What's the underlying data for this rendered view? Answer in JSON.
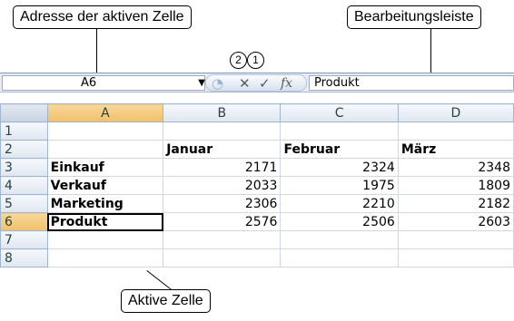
{
  "callouts": {
    "active_cell_address": "Adresse der aktiven Zelle",
    "formula_bar": "Bearbeitungsleiste",
    "active_cell": "Aktive Zelle",
    "marker_2": "2",
    "marker_1": "1"
  },
  "formula_bar": {
    "name_box": "A6",
    "cancel_icon": "✕",
    "enter_icon": "✓",
    "fx_label": "fx",
    "content": "Produkt"
  },
  "sheet": {
    "columns": [
      "A",
      "B",
      "C",
      "D"
    ],
    "rows": [
      {
        "num": "1",
        "cells": [
          "",
          "",
          "",
          ""
        ]
      },
      {
        "num": "2",
        "cells": [
          "",
          "Januar",
          "Februar",
          "März"
        ]
      },
      {
        "num": "3",
        "cells": [
          "Einkauf",
          "2171",
          "2324",
          "2348"
        ]
      },
      {
        "num": "4",
        "cells": [
          "Verkauf",
          "2033",
          "1975",
          "1809"
        ]
      },
      {
        "num": "5",
        "cells": [
          "Marketing",
          "2306",
          "2210",
          "2182"
        ]
      },
      {
        "num": "6",
        "cells": [
          "Produkt",
          "2576",
          "2506",
          "2603"
        ]
      },
      {
        "num": "7",
        "cells": [
          "",
          "",
          "",
          ""
        ]
      },
      {
        "num": "8",
        "cells": [
          "",
          "",
          "",
          ""
        ]
      }
    ]
  },
  "colors": {
    "header_bg": "#dfe6f0",
    "selected_header": "#f2c06a",
    "grid_line": "#d0d7e5"
  }
}
